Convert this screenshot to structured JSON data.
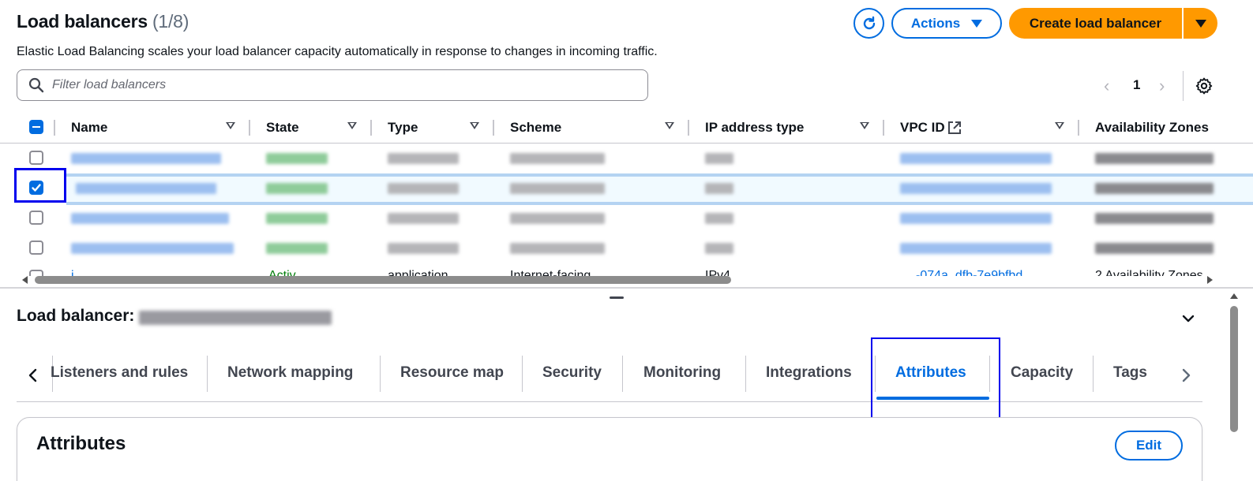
{
  "header": {
    "title": "Load balancers",
    "count": "(1/8)",
    "description": "Elastic Load Balancing scales your load balancer capacity automatically in response to changes in incoming traffic.",
    "actions_label": "Actions",
    "create_label": "Create load balancer"
  },
  "filter": {
    "placeholder": "Filter load balancers"
  },
  "pagination": {
    "current_page": "1"
  },
  "table": {
    "columns": [
      "Name",
      "State",
      "Type",
      "Scheme",
      "IP address type",
      "VPC ID",
      "Availability Zones"
    ],
    "selected_row_index": 1,
    "partial_row": {
      "name": "i",
      "state": "Activ",
      "type": "application",
      "scheme": "Internet-facing",
      "ip": "IPv4",
      "vpc": "-074a_dfb-7e9bfbd",
      "az": "2 Availability Zones"
    }
  },
  "details": {
    "title": "Load balancer:",
    "tabs": [
      "Listeners and rules",
      "Network mapping",
      "Resource map",
      "Security",
      "Monitoring",
      "Integrations",
      "Attributes",
      "Capacity",
      "Tags"
    ],
    "active_tab": "Attributes",
    "card_title": "Attributes",
    "edit_label": "Edit"
  },
  "colors": {
    "accent": "#006ce0",
    "primary_button": "#ff9900",
    "focus_ring": "#0000ee",
    "selected_row": "#f1faff"
  },
  "icons": [
    "refresh-icon",
    "caret-down-icon",
    "search-icon",
    "chevron-left-icon",
    "chevron-right-icon",
    "settings-gear-icon",
    "external-link-icon",
    "chevron-down-icon",
    "sort-icon",
    "checkbox-icon"
  ]
}
